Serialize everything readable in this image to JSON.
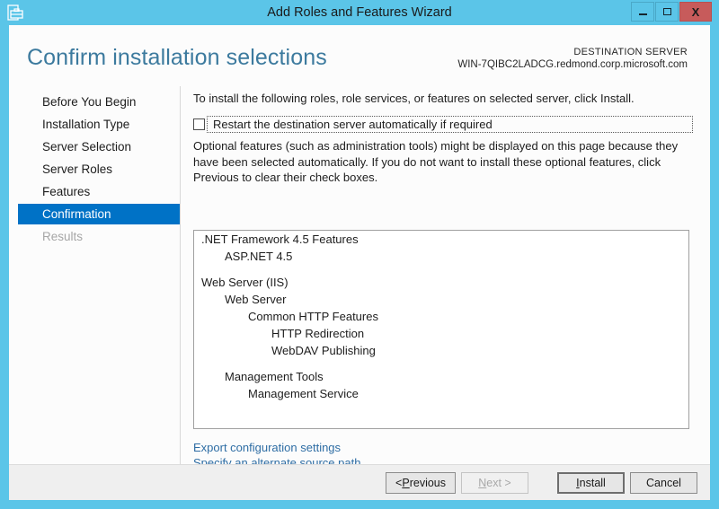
{
  "window": {
    "title": "Add Roles and Features Wizard",
    "icon": "server-wizard-icon",
    "controls": {
      "minimize": "minimize-icon",
      "maximize": "maximize-icon",
      "close": "X"
    }
  },
  "header": {
    "page_title": "Confirm installation selections",
    "destination_label": "DESTINATION SERVER",
    "destination_value": "WIN-7QIBC2LADCG.redmond.corp.microsoft.com"
  },
  "sidebar": {
    "items": [
      {
        "label": "Before You Begin",
        "state": "normal"
      },
      {
        "label": "Installation Type",
        "state": "normal"
      },
      {
        "label": "Server Selection",
        "state": "normal"
      },
      {
        "label": "Server Roles",
        "state": "normal"
      },
      {
        "label": "Features",
        "state": "normal"
      },
      {
        "label": "Confirmation",
        "state": "selected"
      },
      {
        "label": "Results",
        "state": "disabled"
      }
    ]
  },
  "content": {
    "intro_text": "To install the following roles, role services, or features on selected server, click Install.",
    "restart_checkbox_label": "Restart the destination server automatically if required",
    "restart_checkbox_checked": false,
    "optional_text": "Optional features (such as administration tools) might be displayed on this page because they have been selected automatically. If you do not want to install these optional features, click Previous to clear their check boxes.",
    "selections": [
      {
        "label": ".NET Framework 4.5 Features",
        "level": 0
      },
      {
        "label": "ASP.NET 4.5",
        "level": 1
      },
      {
        "label": "",
        "level": -1
      },
      {
        "label": "Web Server (IIS)",
        "level": 0
      },
      {
        "label": "Web Server",
        "level": 1
      },
      {
        "label": "Common HTTP Features",
        "level": 2
      },
      {
        "label": "HTTP Redirection",
        "level": 3
      },
      {
        "label": "WebDAV Publishing",
        "level": 3
      },
      {
        "label": "",
        "level": -1
      },
      {
        "label": "Management Tools",
        "level": 1
      },
      {
        "label": "Management Service",
        "level": 2
      }
    ],
    "links": [
      "Export configuration settings",
      "Specify an alternate source path"
    ]
  },
  "footer": {
    "buttons": [
      {
        "label": "< Previous",
        "accel": "P",
        "state": "normal"
      },
      {
        "label": "Next >",
        "accel": "N",
        "state": "disabled"
      },
      {
        "label": "Install",
        "accel": "I",
        "state": "default"
      },
      {
        "label": "Cancel",
        "accel": "",
        "state": "normal"
      }
    ]
  },
  "colors": {
    "titlebar": "#5bc5e8",
    "selection": "#0072c6",
    "heading": "#3c7a9e",
    "link": "#2e6da4",
    "close_button": "#c75b5b",
    "footer": "#efefef"
  }
}
